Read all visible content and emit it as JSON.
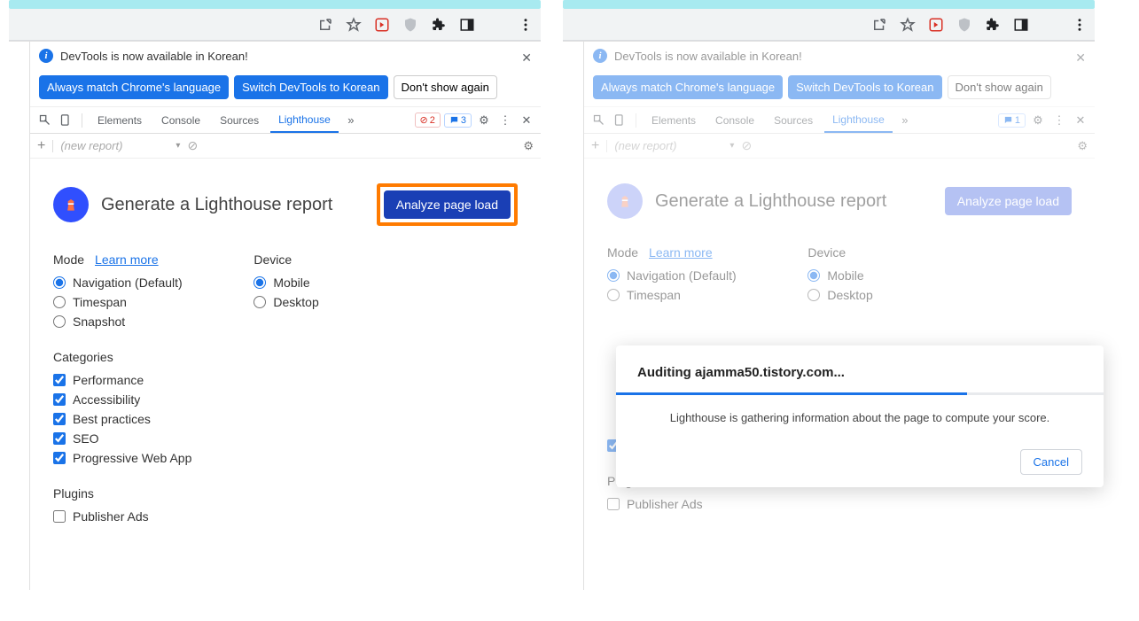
{
  "infobar": {
    "message": "DevTools is now available in Korean!",
    "always_match": "Always match Chrome's language",
    "switch_to": "Switch DevTools to Korean",
    "dont_show": "Don't show again"
  },
  "tabs": {
    "elements": "Elements",
    "console": "Console",
    "sources": "Sources",
    "lighthouse": "Lighthouse"
  },
  "badges": {
    "errors": "2",
    "messages_left": "3",
    "messages_right": "1"
  },
  "subbar": {
    "new_report": "(new report)"
  },
  "lighthouse": {
    "title": "Generate a Lighthouse report",
    "analyze": "Analyze page load",
    "mode_label": "Mode",
    "learn_more": "Learn more",
    "device_label": "Device",
    "modes": {
      "navigation": "Navigation (Default)",
      "timespan": "Timespan",
      "snapshot": "Snapshot"
    },
    "devices": {
      "mobile": "Mobile",
      "desktop": "Desktop"
    },
    "categories_label": "Categories",
    "categories": {
      "performance": "Performance",
      "accessibility": "Accessibility",
      "best_practices": "Best practices",
      "seo": "SEO",
      "pwa": "Progressive Web App"
    },
    "plugins_label": "Plugins",
    "plugins": {
      "publisher_ads": "Publisher Ads"
    }
  },
  "modal": {
    "title": "Auditing ajamma50.tistory.com...",
    "message": "Lighthouse is gathering information about the page to compute your score.",
    "cancel": "Cancel"
  }
}
